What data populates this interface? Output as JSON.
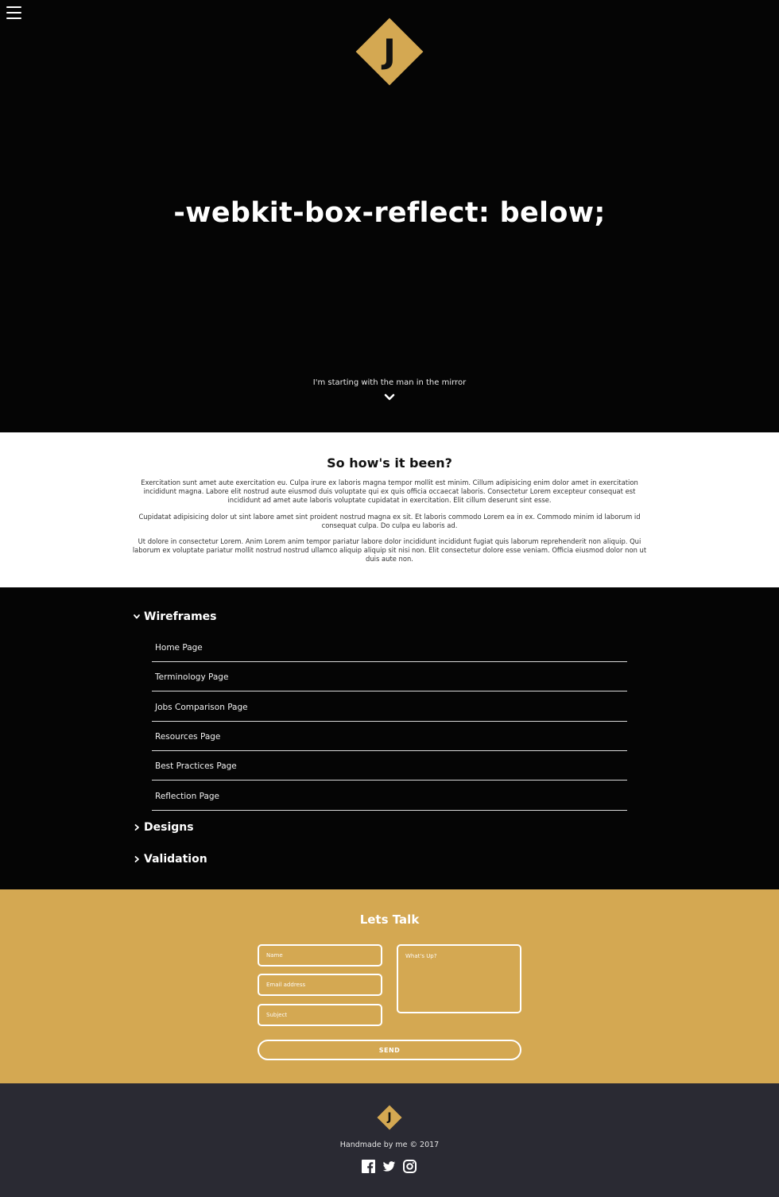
{
  "hero": {
    "logo_letter": "J",
    "title": "-webkit-box-reflect: below;",
    "subtitle": "I'm starting with the man in the mirror",
    "menu_icon": "hamburger-menu-icon",
    "scroll_icon": "chevron-down-icon"
  },
  "about": {
    "heading": "So how's it been?",
    "paragraphs": [
      "Exercitation sunt amet aute exercitation eu. Culpa irure ex laboris magna tempor mollit est minim. Cillum adipisicing enim dolor amet in exercitation incididunt magna. Labore elit nostrud aute eiusmod duis voluptate qui ex quis officia occaecat laboris. Consectetur Lorem excepteur consequat est incididunt ad amet aute laboris voluptate cupidatat in exercitation. Elit cillum deserunt sint esse.",
      "Cupidatat adipisicing dolor ut sint labore amet sint proident nostrud magna ex sit. Et laboris commodo Lorem ea in ex. Commodo minim id laborum id consequat culpa. Do culpa eu laboris ad.",
      "Ut dolore in consectetur Lorem. Anim Lorem anim tempor pariatur labore dolor incididunt incididunt fugiat quis laborum reprehenderit non aliquip. Qui laborum ex voluptate pariatur mollit nostrud nostrud ullamco aliquip aliquip sit nisi non. Elit consectetur dolore esse veniam. Officia eiusmod dolor non ut duis aute non."
    ]
  },
  "projects": {
    "sections": [
      {
        "label": "Wireframes",
        "expanded": true,
        "items": [
          "Home Page",
          "Terminology Page",
          "Jobs Comparison Page",
          "Resources Page",
          "Best Practices Page",
          "Reflection Page"
        ]
      },
      {
        "label": "Designs",
        "expanded": false,
        "items": []
      },
      {
        "label": "Validation",
        "expanded": false,
        "items": []
      }
    ]
  },
  "contact": {
    "heading": "Lets Talk",
    "name_placeholder": "Name",
    "email_placeholder": "Email address",
    "subject_placeholder": "Subject",
    "message_placeholder": "What's Up?",
    "send_label": "SEND"
  },
  "footer": {
    "logo_letter": "J",
    "credit": "Handmade by me © 2017",
    "social_icons": [
      "facebook-icon",
      "twitter-icon",
      "instagram-icon"
    ]
  },
  "colors": {
    "accent": "#d4a852",
    "dark": "#050505",
    "footer_bg": "#2a2a33",
    "light_bg": "#ffffff"
  }
}
